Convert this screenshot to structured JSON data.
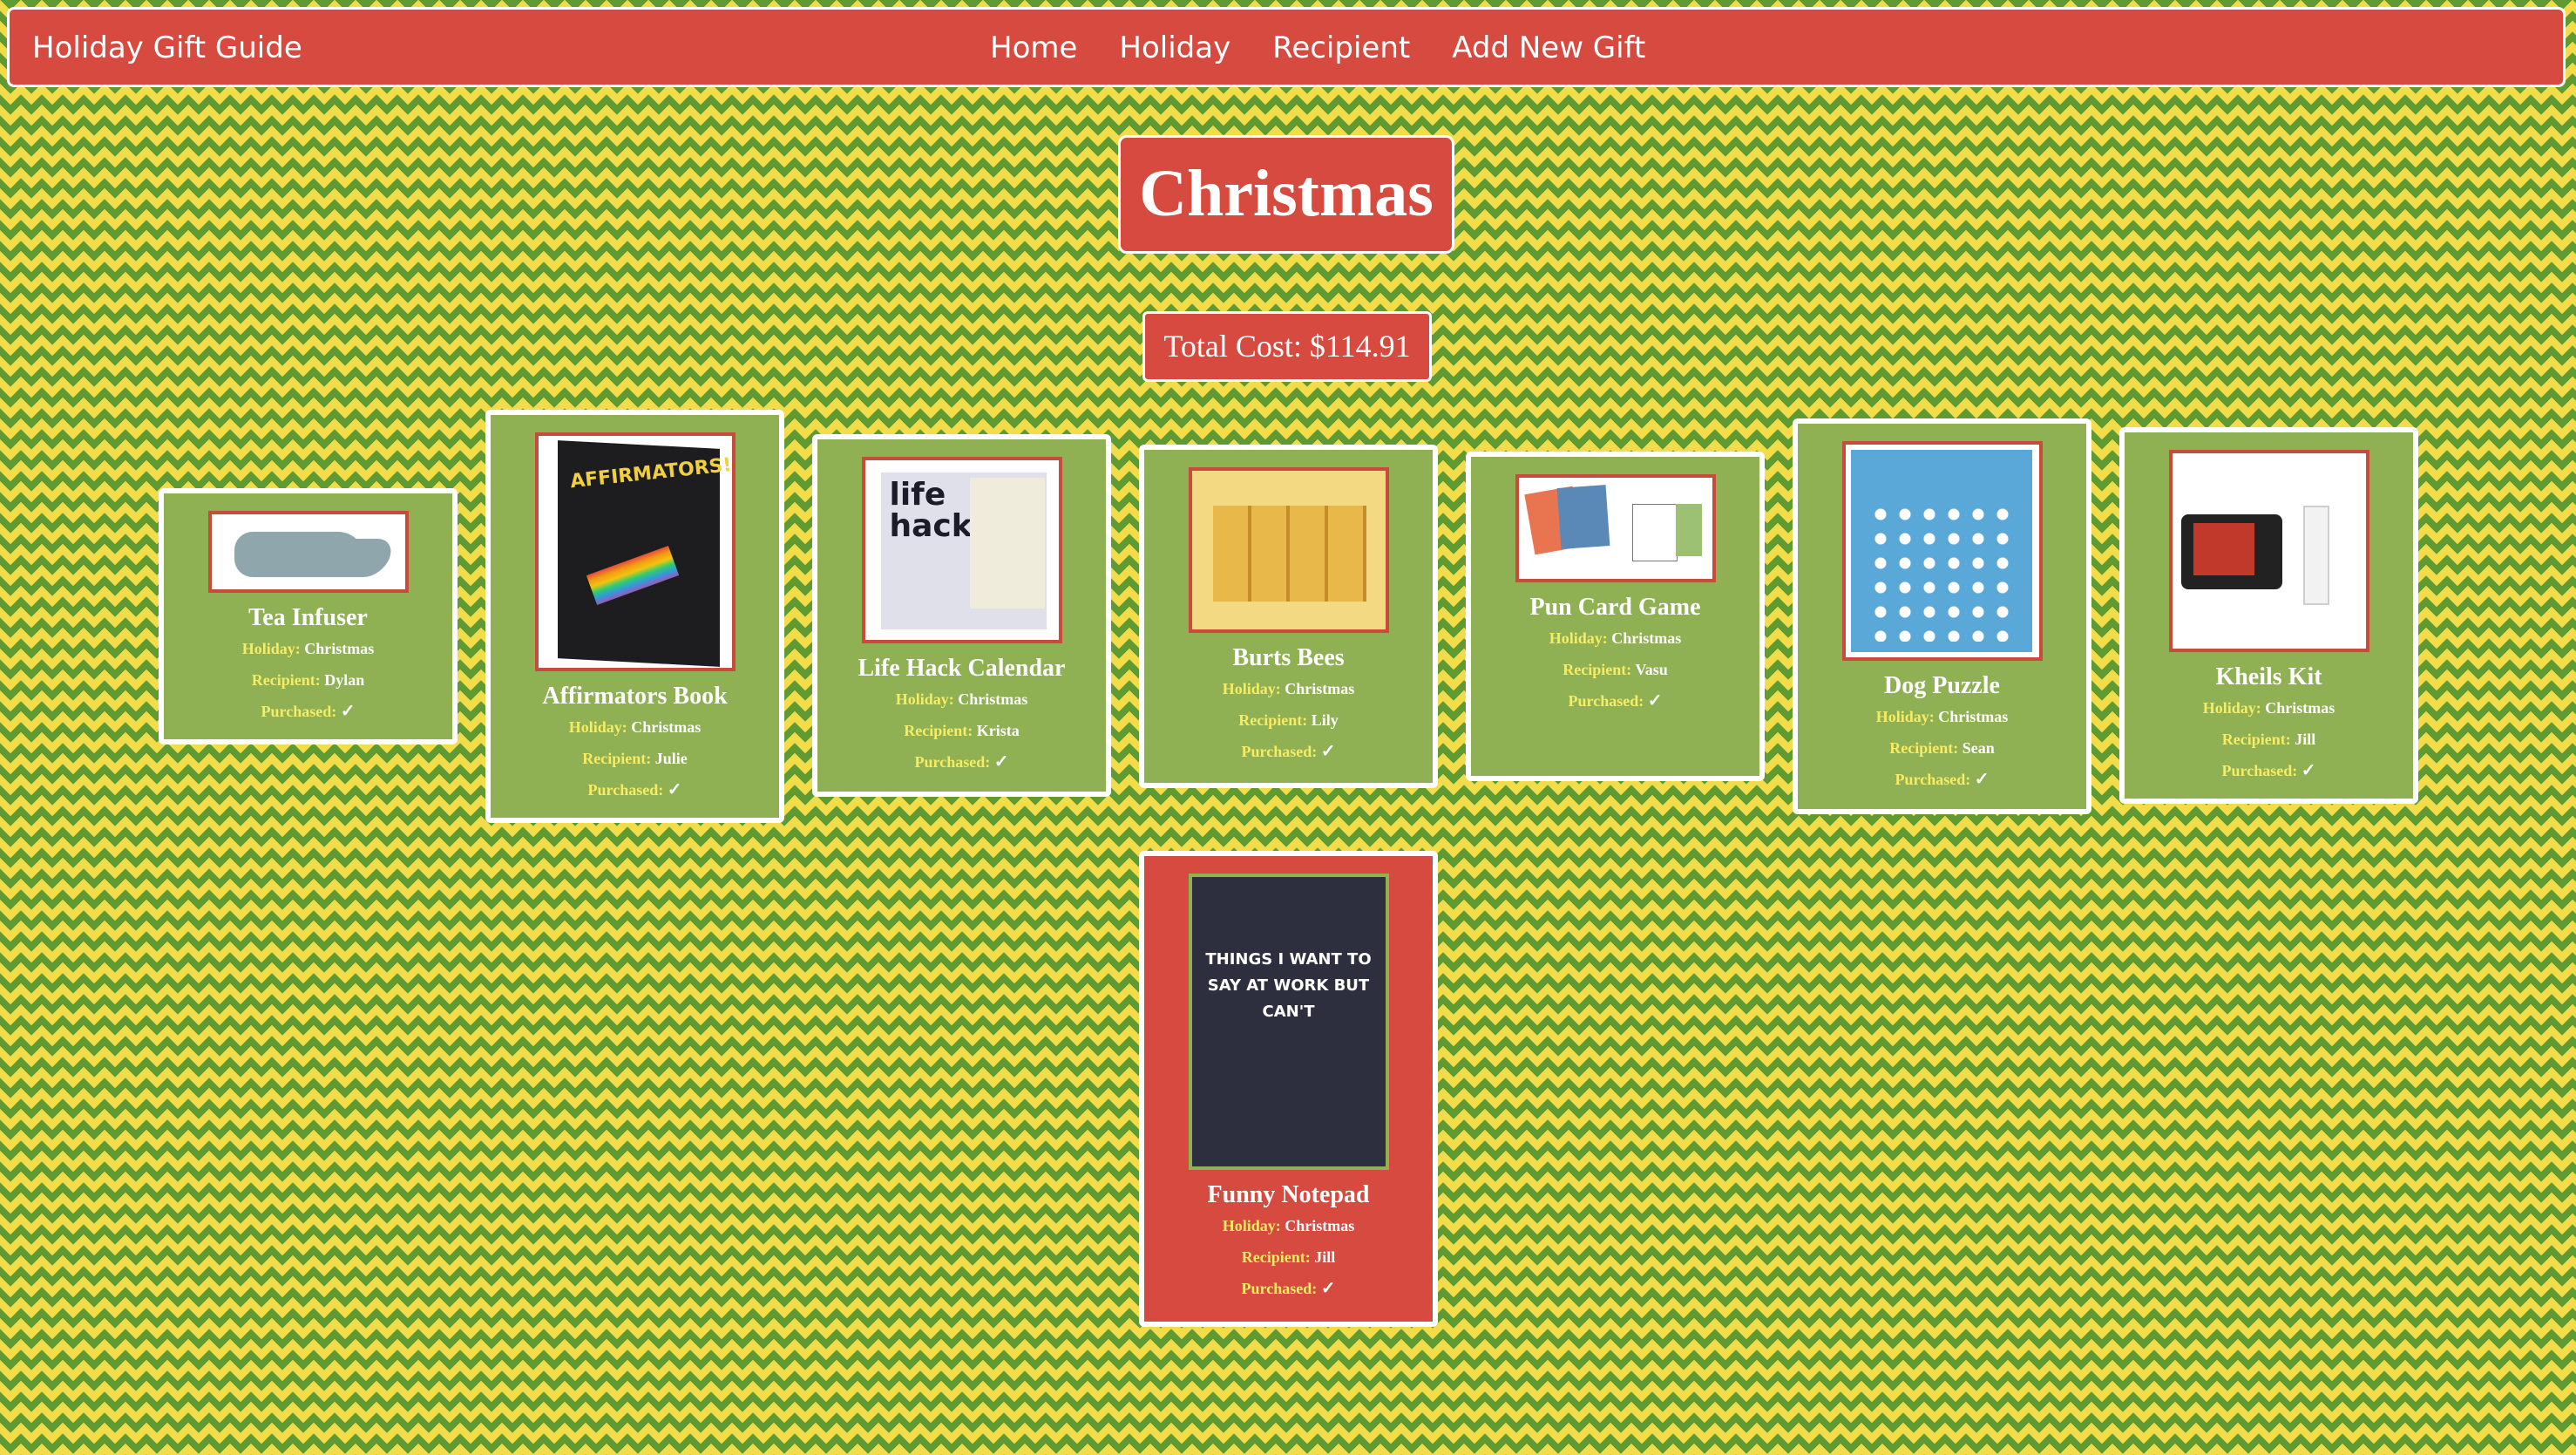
{
  "nav": {
    "brand": "Holiday Gift Guide",
    "links": [
      "Home",
      "Holiday",
      "Recipient",
      "Add New Gift"
    ]
  },
  "page": {
    "title": "Christmas",
    "total_cost": "Total Cost: $114.91"
  },
  "labels": {
    "holiday": "Holiday:",
    "recipient": "Recipient:",
    "purchased": "Purchased:",
    "check": "✓"
  },
  "gifts": [
    {
      "name": "Tea Infuser",
      "holiday": "Christmas",
      "recipient": "Dylan",
      "purchased": true,
      "image": "manatee-tea-infuser"
    },
    {
      "name": "Affirmators Book",
      "holiday": "Christmas",
      "recipient": "Julie",
      "purchased": true,
      "image": "affirmators-book",
      "image_text": "AFFIRMATORS!"
    },
    {
      "name": "Life Hack Calendar",
      "holiday": "Christmas",
      "recipient": "Krista",
      "purchased": true,
      "image": "life-hacks-calendar",
      "image_text": "life hacks"
    },
    {
      "name": "Burts Bees",
      "holiday": "Christmas",
      "recipient": "Lily",
      "purchased": true,
      "image": "burts-bees-kit"
    },
    {
      "name": "Pun Card Game",
      "holiday": "Christmas",
      "recipient": "Vasu",
      "purchased": true,
      "image": "pun-card-game"
    },
    {
      "name": "Dog Puzzle",
      "holiday": "Christmas",
      "recipient": "Sean",
      "purchased": true,
      "image": "dog-puzzle"
    },
    {
      "name": "Kheils Kit",
      "holiday": "Christmas",
      "recipient": "Jill",
      "purchased": true,
      "image": "kiehls-kit"
    },
    {
      "name": "Funny Notepad",
      "holiday": "Christmas",
      "recipient": "Jill",
      "purchased": true,
      "image": "funny-notepad",
      "image_text": "THINGS I WANT TO SAY AT WORK BUT CAN'T"
    }
  ],
  "colors": {
    "red": "#d64a40",
    "card_green": "#8fb053",
    "label_yellow": "#f7ec63",
    "pattern_green": "#5f9a33",
    "pattern_yellow": "#f2dc4a"
  }
}
